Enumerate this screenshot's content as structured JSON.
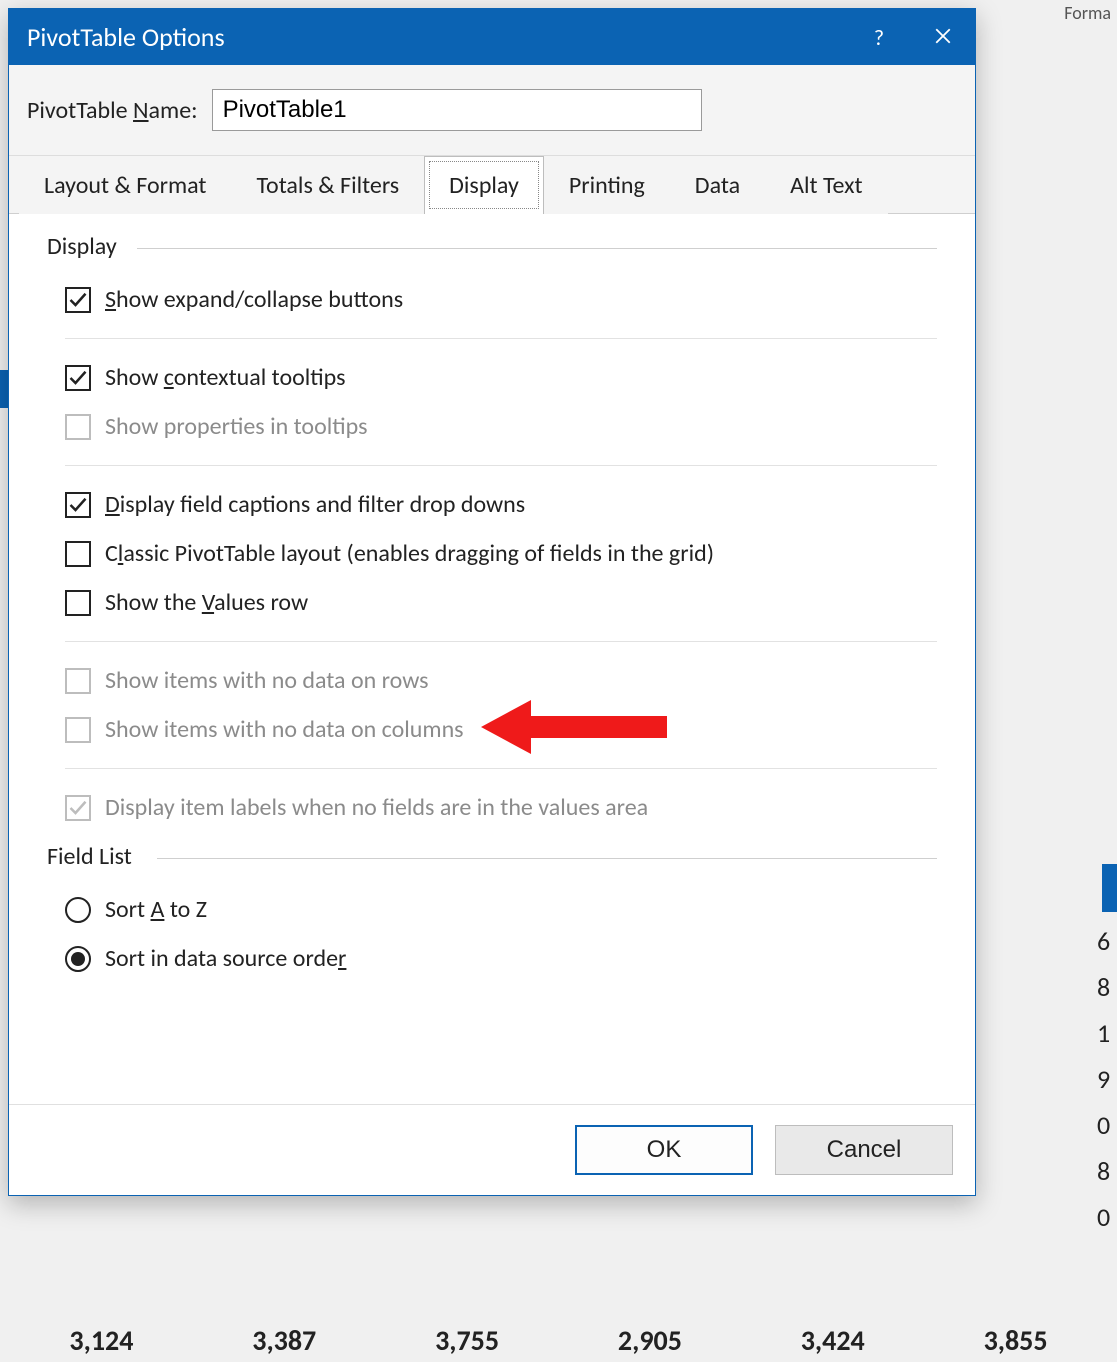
{
  "background": {
    "ribbon_fragment": "Forma",
    "side_digits": [
      "6",
      "8",
      "1",
      "9",
      "0",
      "8",
      "0"
    ],
    "bottom_row": [
      "3,124",
      "3,387",
      "3,755",
      "2,905",
      "3,424",
      "3,855"
    ]
  },
  "dialog": {
    "title": "PivotTable Options",
    "help_tooltip": "?",
    "close_tooltip": "Close",
    "name_label_pre": "PivotTable ",
    "name_label_mn": "N",
    "name_label_post": "ame:",
    "name_value": "PivotTable1",
    "tabs": [
      {
        "label": "Layout & Format",
        "active": false
      },
      {
        "label": "Totals & Filters",
        "active": false
      },
      {
        "label": "Display",
        "active": true
      },
      {
        "label": "Printing",
        "active": false
      },
      {
        "label": "Data",
        "active": false
      },
      {
        "label": "Alt Text",
        "active": false
      }
    ],
    "group_display_title": "Display",
    "opts": {
      "expand": {
        "checked": true,
        "disabled": false,
        "pre": "",
        "mn": "S",
        "post": "how expand/collapse buttons"
      },
      "ctx": {
        "checked": true,
        "disabled": false,
        "pre": "Show ",
        "mn": "c",
        "post": "ontextual tooltips"
      },
      "prop": {
        "checked": false,
        "disabled": true,
        "pre": "Show properties in tooltips",
        "mn": "",
        "post": ""
      },
      "caps": {
        "checked": true,
        "disabled": false,
        "pre": "",
        "mn": "D",
        "post": "isplay field captions and filter drop downs"
      },
      "classic": {
        "checked": false,
        "disabled": false,
        "pre": "C",
        "mn": "l",
        "post": "assic PivotTable layout (enables dragging of fields in the grid)"
      },
      "values": {
        "checked": false,
        "disabled": false,
        "pre": "Show the ",
        "mn": "V",
        "post": "alues row"
      },
      "nodatarow": {
        "checked": false,
        "disabled": true,
        "pre": "Show items with no data on rows",
        "mn": "",
        "post": ""
      },
      "nodatacol": {
        "checked": false,
        "disabled": true,
        "pre": "Show items with no data on columns",
        "mn": "",
        "post": ""
      },
      "itemlbl": {
        "checked": true,
        "disabled": true,
        "pre": "Display item labels when no fields are in the values area",
        "mn": "",
        "post": ""
      }
    },
    "group_fieldlist_title": "Field List",
    "radios": {
      "az": {
        "selected": false,
        "pre": "Sort ",
        "mn": "A",
        "post": " to Z"
      },
      "src": {
        "selected": true,
        "pre": "Sort in data source orde",
        "mn": "r",
        "post": ""
      }
    },
    "ok_label": "OK",
    "cancel_label": "Cancel"
  },
  "colors": {
    "accent": "#0b63b3",
    "annotation": "#ef1a1a"
  }
}
